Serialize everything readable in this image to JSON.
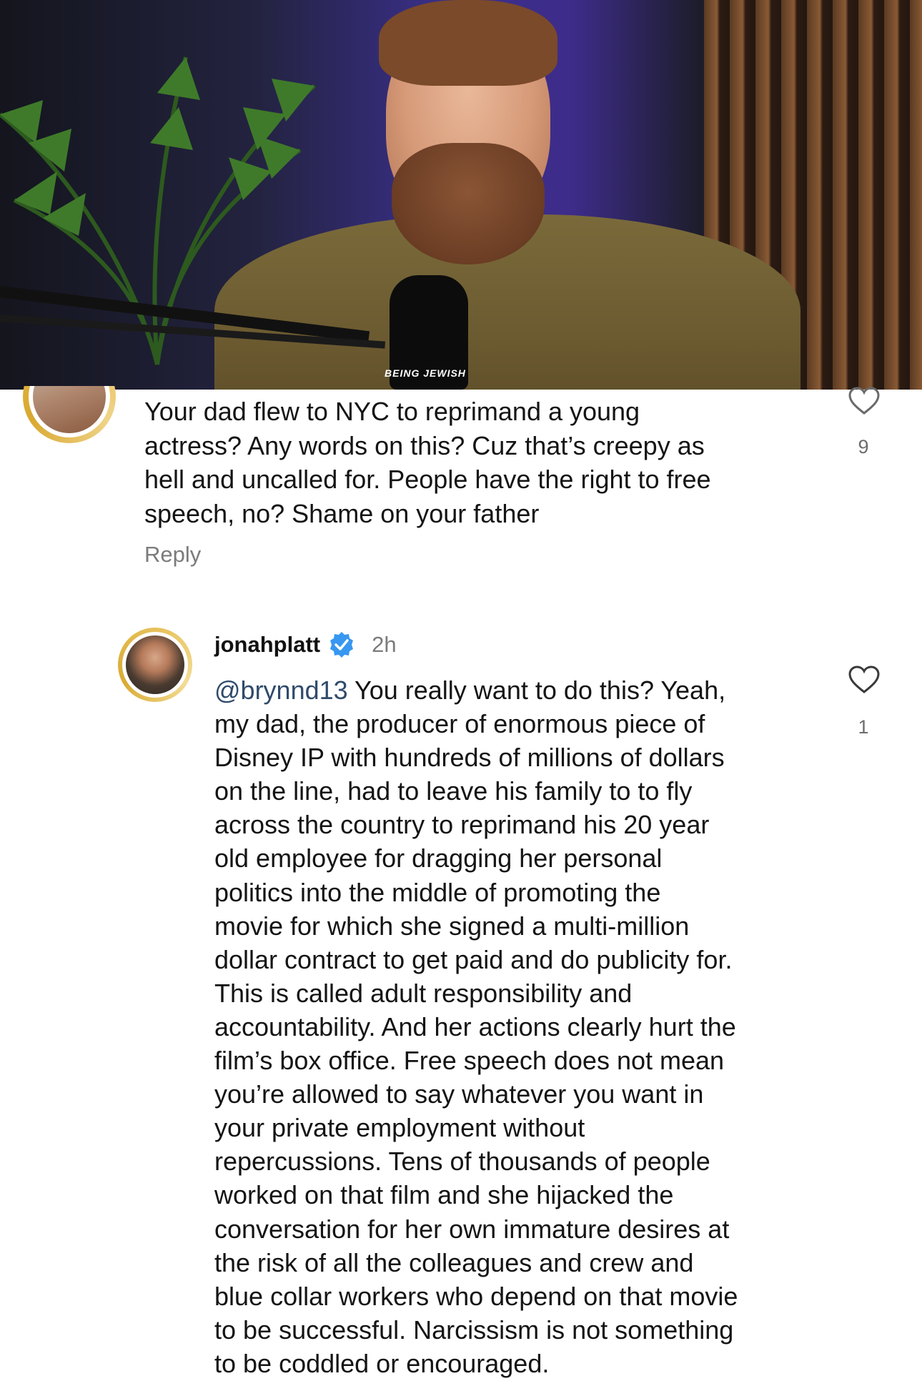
{
  "video": {
    "mic_label": "BEING JEWISH"
  },
  "comment1": {
    "text": "Your dad flew to NYC to reprimand a young\nactress? Any words on this? Cuz that’s creepy as\nhell and uncalled for. People have the right to free\nspeech, no? Shame on your father",
    "reply_label": "Reply",
    "like_count": "9"
  },
  "comment2": {
    "username": "jonahplatt",
    "time": "2h",
    "mention": "@brynnd13",
    "text": " You really want to do this? Yeah,\nmy dad, the producer of enormous piece of\nDisney IP with hundreds of millions of dollars\non the line, had to leave his family to to fly\nacross the country to reprimand his 20 year\nold employee for dragging her personal\npolitics into the middle of promoting the\nmovie for which she signed a multi-million\ndollar contract to get paid and do publicity for.\nThis is called adult responsibility and\naccountability. And her actions clearly hurt the\nfilm’s box office. Free speech does not mean\nyou’re allowed to say whatever you want in\nyour private employment without\nrepercussions. Tens of thousands of people\nworked on that film and she hijacked the\nconversation for her own immature desires at\nthe risk of all the colleagues and crew and\nblue collar workers who depend on that movie\nto be successful. Narcissism is not something\nto be coddled or encouraged.",
    "like_count": "1"
  },
  "colors": {
    "verified_badge": "#3897f0",
    "avatar_ring": "#e6c15a",
    "secondary_text": "#7b7b7b"
  }
}
